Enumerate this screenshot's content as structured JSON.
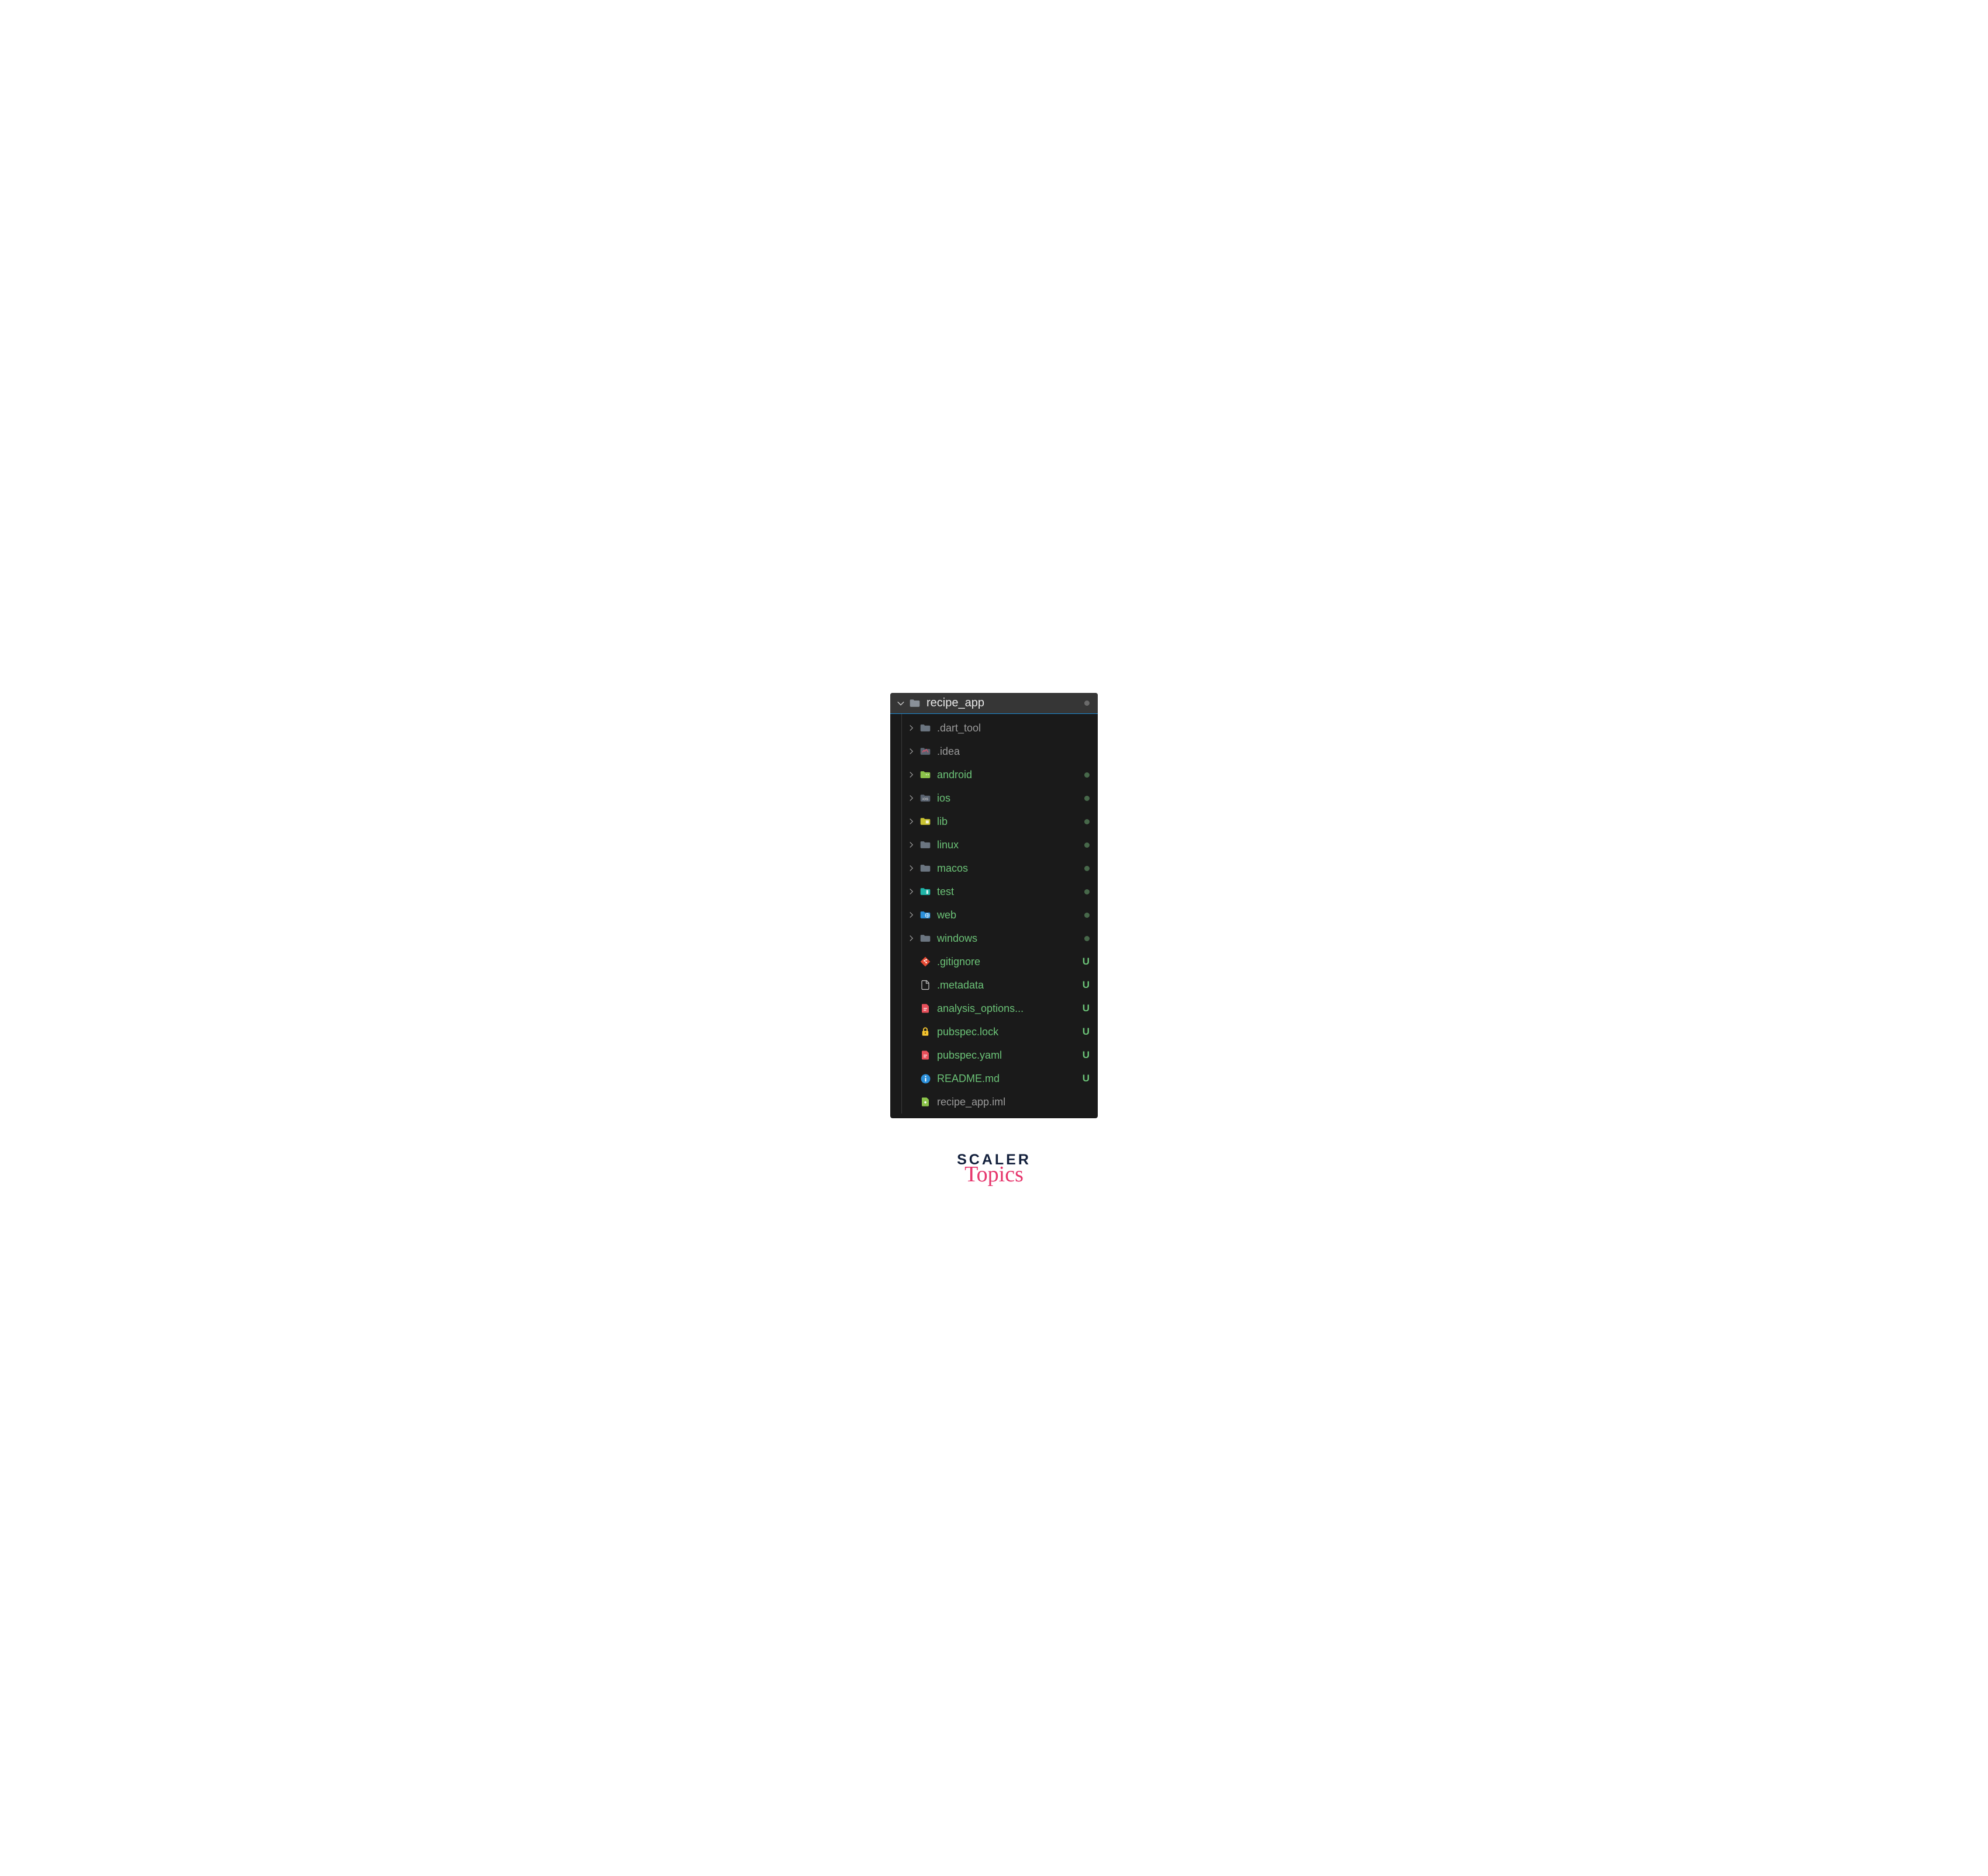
{
  "root": {
    "name": "recipe_app",
    "status": "dot-gray"
  },
  "items": [
    {
      "type": "folder",
      "name": ".dart_tool",
      "icon": "folder-gray",
      "labelClass": "label-muted",
      "chevron": true
    },
    {
      "type": "folder",
      "name": ".idea",
      "icon": "idea",
      "labelClass": "label-muted",
      "chevron": true
    },
    {
      "type": "folder",
      "name": "android",
      "icon": "android",
      "labelClass": "label-green",
      "chevron": true,
      "status": "dot-green"
    },
    {
      "type": "folder",
      "name": "ios",
      "icon": "ios",
      "labelClass": "label-green",
      "chevron": true,
      "status": "dot-green"
    },
    {
      "type": "folder",
      "name": "lib",
      "icon": "lib",
      "labelClass": "label-green",
      "chevron": true,
      "status": "dot-green"
    },
    {
      "type": "folder",
      "name": "linux",
      "icon": "folder-gray",
      "labelClass": "label-green",
      "chevron": true,
      "status": "dot-green"
    },
    {
      "type": "folder",
      "name": "macos",
      "icon": "folder-gray",
      "labelClass": "label-green",
      "chevron": true,
      "status": "dot-green"
    },
    {
      "type": "folder",
      "name": "test",
      "icon": "test",
      "labelClass": "label-green",
      "chevron": true,
      "status": "dot-green"
    },
    {
      "type": "folder",
      "name": "web",
      "icon": "web",
      "labelClass": "label-green",
      "chevron": true,
      "status": "dot-green"
    },
    {
      "type": "folder",
      "name": "windows",
      "icon": "folder-gray",
      "labelClass": "label-green",
      "chevron": true,
      "status": "dot-green"
    },
    {
      "type": "file",
      "name": ".gitignore",
      "icon": "git",
      "labelClass": "label-green",
      "statusLetter": "U"
    },
    {
      "type": "file",
      "name": ".metadata",
      "icon": "file-outline",
      "labelClass": "label-green",
      "statusLetter": "U"
    },
    {
      "type": "file",
      "name": "analysis_options...",
      "icon": "yaml",
      "labelClass": "label-green",
      "statusLetter": "U"
    },
    {
      "type": "file",
      "name": "pubspec.lock",
      "icon": "lock",
      "labelClass": "label-green",
      "statusLetter": "U"
    },
    {
      "type": "file",
      "name": "pubspec.yaml",
      "icon": "yaml",
      "labelClass": "label-green",
      "statusLetter": "U"
    },
    {
      "type": "file",
      "name": "README.md",
      "icon": "info",
      "labelClass": "label-green",
      "statusLetter": "U"
    },
    {
      "type": "file",
      "name": "recipe_app.iml",
      "icon": "iml",
      "labelClass": "label-muted"
    }
  ],
  "watermark": {
    "line1": "SCALER",
    "line2": "Topics"
  }
}
